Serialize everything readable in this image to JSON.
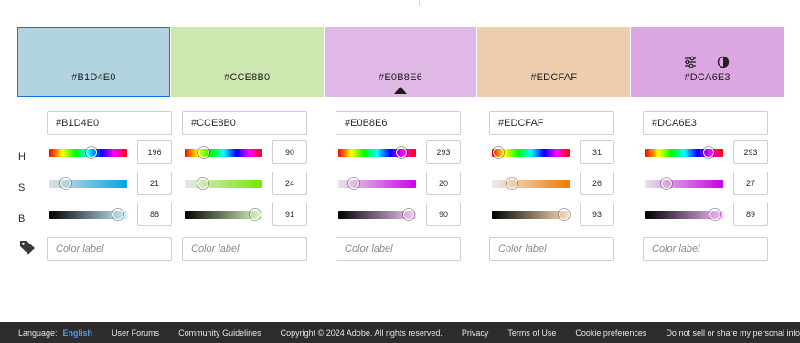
{
  "swatches": [
    {
      "hex": "#B1D4E0",
      "label": "#B1D4E0",
      "selected": true
    },
    {
      "hex": "#CCE8B0",
      "label": "#CCE8B0"
    },
    {
      "hex": "#E0B8E6",
      "label": "#E0B8E6",
      "base": true
    },
    {
      "hex": "#EDCFAF",
      "label": "#EDCFAF"
    },
    {
      "hex": "#DCA6E3",
      "label": "#DCA6E3",
      "tools": [
        "sliders-icon",
        "contrast-icon"
      ]
    }
  ],
  "row_labels": {
    "h": "H",
    "s": "S",
    "b": "B"
  },
  "columns": [
    {
      "hex": "#B1D4E0",
      "h": 196,
      "s": 21,
      "b": 88,
      "color_label_placeholder": "Color label"
    },
    {
      "hex": "#CCE8B0",
      "h": 90,
      "s": 24,
      "b": 91,
      "color_label_placeholder": "Color label"
    },
    {
      "hex": "#E0B8E6",
      "h": 293,
      "s": 20,
      "b": 90,
      "color_label_placeholder": "Color label"
    },
    {
      "hex": "#EDCFAF",
      "h": 31,
      "s": 26,
      "b": 93,
      "color_label_placeholder": "Color label"
    },
    {
      "hex": "#DCA6E3",
      "h": 293,
      "s": 27,
      "b": 89,
      "color_label_placeholder": "Color label"
    }
  ],
  "footer": {
    "language_label": "Language:",
    "language_value": "English",
    "links": [
      "User Forums",
      "Community Guidelines",
      "Copyright © 2024 Adobe. All rights reserved.",
      "Privacy",
      "Terms of Use",
      "Cookie preferences",
      "Do not sell or share my personal information"
    ]
  },
  "colors": {
    "footer_bg": "#2c2c2c",
    "accent": "#1473e6",
    "link_blue": "#4b9cf5"
  }
}
